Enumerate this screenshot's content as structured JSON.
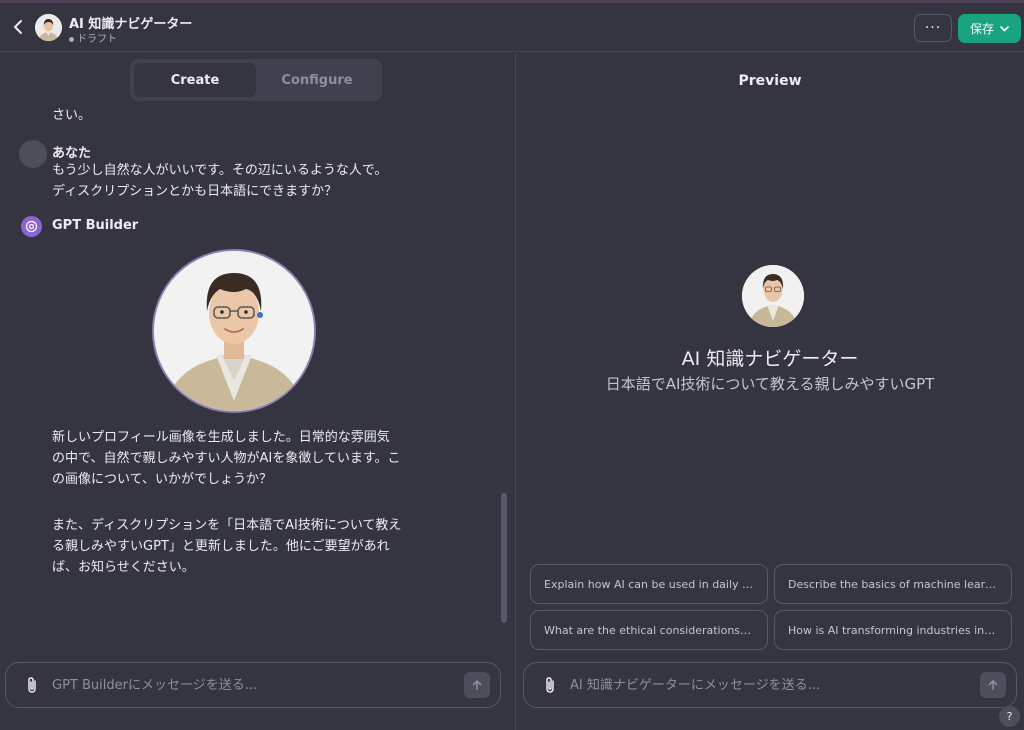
{
  "header": {
    "title": "AI 知識ナビゲーター",
    "status": "ドラフト",
    "more_label": "···",
    "save_label": "保存"
  },
  "tabs": [
    {
      "label": "Create",
      "active": true
    },
    {
      "label": "Configure",
      "active": false
    }
  ],
  "conversation": {
    "previous_tail": "さい。",
    "user": {
      "name": "あなた",
      "lines": [
        "もう少し自然な人がいいです。その辺にいるような人で。",
        "ディスクリプションとかも日本語にできますか？"
      ]
    },
    "builder": {
      "name": "GPT Builder",
      "paragraph1": [
        "新しいプロフィール画像を生成しました。日常的な雰囲気",
        "の中で、自然で親しみやすい人物がAIを象徴しています。こ",
        "の画像について、いかがでしょうか？"
      ],
      "paragraph2": [
        "また、ディスクリプションを「日本語でAI技術について教え",
        "る親しみやすいGPT」と更新しました。他にご要望があれ",
        "ば、お知らせください。"
      ]
    }
  },
  "left_composer": {
    "placeholder": "GPT Builderにメッセージを送る..."
  },
  "preview": {
    "title": "Preview",
    "gpt_name": "AI 知識ナビゲーター",
    "gpt_description": "日本語でAI技術について教える親しみやすいGPT",
    "starters": [
      "Explain how AI can be used in daily life...",
      "Describe the basics of machine learning...",
      "What are the ethical considerations of AI...",
      "How is AI transforming industries in Japan..."
    ],
    "composer_placeholder": "AI 知識ナビゲーターにメッセージを送る..."
  },
  "help_label": "?",
  "colors": {
    "background": "#343541",
    "accent_save": "#19a37f",
    "builder_icon": "#8b64d8"
  }
}
